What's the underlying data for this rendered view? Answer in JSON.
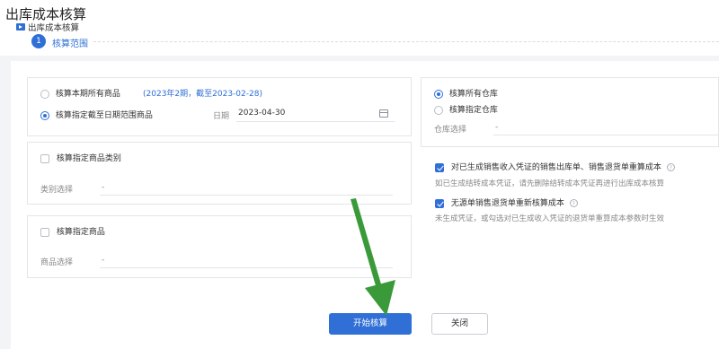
{
  "page": {
    "title": "出库成本核算"
  },
  "tab": {
    "label": "出库成本核算"
  },
  "steps": [
    {
      "number": "1",
      "label": "核算范围"
    }
  ],
  "scope": {
    "option_current_period": "核算本期所有商品",
    "period_note": "(2023年2期，截至2023-02-28)",
    "option_until_date": "核算指定截至日期范围商品",
    "date_label": "日期",
    "date_value": "2023-04-30"
  },
  "category": {
    "checkbox_label": "核算指定商品类别",
    "select_label": "类别选择",
    "select_value": "-"
  },
  "goods": {
    "checkbox_label": "核算指定商品",
    "select_label": "商品选择",
    "select_value": "-"
  },
  "warehouse": {
    "option_all": "核算所有仓库",
    "option_specific": "核算指定仓库",
    "select_label": "仓库选择",
    "select_value": "-"
  },
  "options": {
    "recalc_label": "对已生成销售收入凭证的销售出库单、销售退货单重算成本",
    "recalc_hint": "如已生成结转成本凭证，请先删除结转成本凭证再进行出库成本核算",
    "recalc_checked": true,
    "no_source_label": "无源单销售退货单重新核算成本",
    "no_source_hint": "未生成凭证，或勾选对已生成收入凭证的退货单重算成本参数时生效",
    "no_source_checked": true
  },
  "buttons": {
    "start": "开始核算",
    "close": "关闭"
  },
  "colors": {
    "primary": "#2f6fd6",
    "arrow": "#3a9a3a"
  },
  "icons": [
    "video-tab-icon",
    "calendar-icon",
    "help-icon",
    "annotation-arrow"
  ]
}
